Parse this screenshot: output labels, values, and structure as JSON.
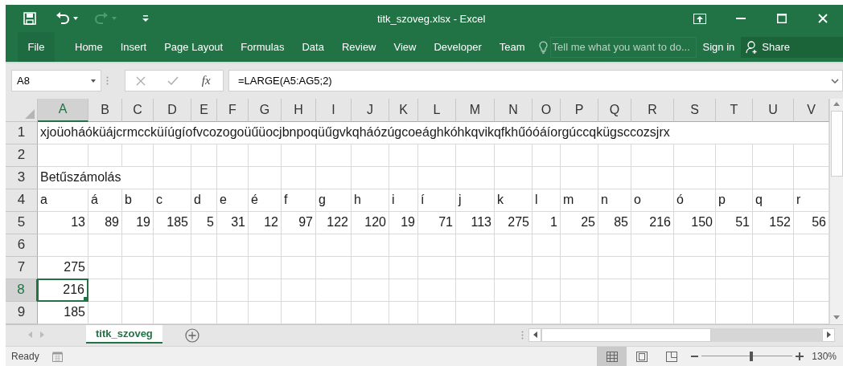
{
  "window": {
    "title": "titk_szoveg.xlsx - Excel"
  },
  "ribbon_tabs": [
    {
      "label": "File",
      "kind": "file",
      "selected": false
    },
    {
      "label": "Home",
      "kind": "tab",
      "selected": false
    },
    {
      "label": "Insert",
      "kind": "tab",
      "selected": false
    },
    {
      "label": "Page Layout",
      "kind": "tab",
      "selected": false
    },
    {
      "label": "Formulas",
      "kind": "tab",
      "selected": false
    },
    {
      "label": "Data",
      "kind": "tab",
      "selected": false
    },
    {
      "label": "Review",
      "kind": "tab",
      "selected": false
    },
    {
      "label": "View",
      "kind": "tab",
      "selected": false
    },
    {
      "label": "Developer",
      "kind": "tab",
      "selected": false
    },
    {
      "label": "Team",
      "kind": "tab",
      "selected": false
    }
  ],
  "tell_me": {
    "placeholder": "Tell me what you want to do..."
  },
  "sign_in": "Sign in",
  "share": "Share",
  "formula_bar": {
    "name_box": "A8",
    "function_button": "fx",
    "formula": "=LARGE(A5:AG5;2)"
  },
  "sheet": {
    "columns": [
      {
        "label": "A",
        "selected": true
      },
      {
        "label": "B",
        "selected": false
      },
      {
        "label": "C",
        "selected": false
      },
      {
        "label": "D",
        "selected": false
      },
      {
        "label": "E",
        "selected": false
      },
      {
        "label": "F",
        "selected": false
      },
      {
        "label": "G",
        "selected": false
      },
      {
        "label": "H",
        "selected": false
      },
      {
        "label": "I",
        "selected": false
      },
      {
        "label": "J",
        "selected": false
      },
      {
        "label": "K",
        "selected": false
      },
      {
        "label": "L",
        "selected": false
      },
      {
        "label": "M",
        "selected": false
      },
      {
        "label": "N",
        "selected": false
      },
      {
        "label": "O",
        "selected": false
      },
      {
        "label": "P",
        "selected": false
      },
      {
        "label": "Q",
        "selected": false
      },
      {
        "label": "R",
        "selected": false
      },
      {
        "label": "S",
        "selected": false
      },
      {
        "label": "T",
        "selected": false
      },
      {
        "label": "U",
        "selected": false
      },
      {
        "label": "V",
        "selected": false
      }
    ],
    "rows": [
      {
        "header": "1",
        "selected": false,
        "cells": [
          {
            "kind": "text",
            "text": "xjoüoháóküájcrmccküíúgíofvcozogoüűüocjbnpoqüűgvkqháózúgcoeághkóhkqvikqfkhűóóáíorgúccqkügsccozsjrx",
            "selected": false
          }
        ]
      },
      {
        "header": "2",
        "selected": false
      },
      {
        "header": "3",
        "selected": false,
        "cells": [
          {
            "kind": "text",
            "text": "Betűszámolás",
            "selected": false
          }
        ]
      },
      {
        "header": "4",
        "selected": false,
        "cells": [
          {
            "kind": "text",
            "text": "a",
            "selected": false
          },
          {
            "kind": "text",
            "text": "á",
            "selected": false
          },
          {
            "kind": "text",
            "text": "b",
            "selected": false
          },
          {
            "kind": "text",
            "text": "c",
            "selected": false
          },
          {
            "kind": "text",
            "text": "d",
            "selected": false
          },
          {
            "kind": "text",
            "text": "e",
            "selected": false
          },
          {
            "kind": "text",
            "text": "é",
            "selected": false
          },
          {
            "kind": "text",
            "text": "f",
            "selected": false
          },
          {
            "kind": "text",
            "text": "g",
            "selected": false
          },
          {
            "kind": "text",
            "text": "h",
            "selected": false
          },
          {
            "kind": "text",
            "text": "i",
            "selected": false
          },
          {
            "kind": "text",
            "text": "í",
            "selected": false
          },
          {
            "kind": "text",
            "text": "j",
            "selected": false
          },
          {
            "kind": "text",
            "text": "k",
            "selected": false
          },
          {
            "kind": "text",
            "text": "l",
            "selected": false
          },
          {
            "kind": "text",
            "text": "m",
            "selected": false
          },
          {
            "kind": "text",
            "text": "n",
            "selected": false
          },
          {
            "kind": "text",
            "text": "o",
            "selected": false
          },
          {
            "kind": "text",
            "text": "ó",
            "selected": false
          },
          {
            "kind": "text",
            "text": "p",
            "selected": false
          },
          {
            "kind": "text",
            "text": "q",
            "selected": false
          },
          {
            "kind": "text",
            "text": "r",
            "selected": false
          }
        ]
      },
      {
        "header": "5",
        "selected": false,
        "cells": [
          {
            "kind": "number",
            "text": "13",
            "selected": false
          },
          {
            "kind": "number",
            "text": "89",
            "selected": false
          },
          {
            "kind": "number",
            "text": "19",
            "selected": false
          },
          {
            "kind": "number",
            "text": "185",
            "selected": false
          },
          {
            "kind": "number",
            "text": "5",
            "selected": false
          },
          {
            "kind": "number",
            "text": "31",
            "selected": false
          },
          {
            "kind": "number",
            "text": "12",
            "selected": false
          },
          {
            "kind": "number",
            "text": "97",
            "selected": false
          },
          {
            "kind": "number",
            "text": "122",
            "selected": false
          },
          {
            "kind": "number",
            "text": "120",
            "selected": false
          },
          {
            "kind": "number",
            "text": "19",
            "selected": false
          },
          {
            "kind": "number",
            "text": "71",
            "selected": false
          },
          {
            "kind": "number",
            "text": "113",
            "selected": false
          },
          {
            "kind": "number",
            "text": "275",
            "selected": false
          },
          {
            "kind": "number",
            "text": "1",
            "selected": false
          },
          {
            "kind": "number",
            "text": "25",
            "selected": false
          },
          {
            "kind": "number",
            "text": "85",
            "selected": false
          },
          {
            "kind": "number",
            "text": "216",
            "selected": false
          },
          {
            "kind": "number",
            "text": "150",
            "selected": false
          },
          {
            "kind": "number",
            "text": "51",
            "selected": false
          },
          {
            "kind": "number",
            "text": "152",
            "selected": false
          },
          {
            "kind": "number",
            "text": "56",
            "selected": false
          }
        ]
      },
      {
        "header": "6",
        "selected": false
      },
      {
        "header": "7",
        "selected": false,
        "cells": [
          {
            "kind": "number",
            "text": "275",
            "selected": false
          }
        ]
      },
      {
        "header": "8",
        "selected": true,
        "cells": [
          {
            "kind": "number",
            "text": "216",
            "selected": true
          }
        ]
      },
      {
        "header": "9",
        "selected": false,
        "cells": [
          {
            "kind": "number",
            "text": "185",
            "selected": false
          }
        ]
      }
    ]
  },
  "sheet_tabs": [
    {
      "label": "titk_szoveg",
      "selected": true
    }
  ],
  "status_bar": {
    "status": "Ready",
    "views": [
      {
        "kind": "normal",
        "selected": true
      },
      {
        "kind": "page_layout",
        "selected": false
      },
      {
        "kind": "page_break",
        "selected": false
      }
    ],
    "zoom_slider": {
      "level": 0.55
    },
    "zoom": "130%"
  }
}
